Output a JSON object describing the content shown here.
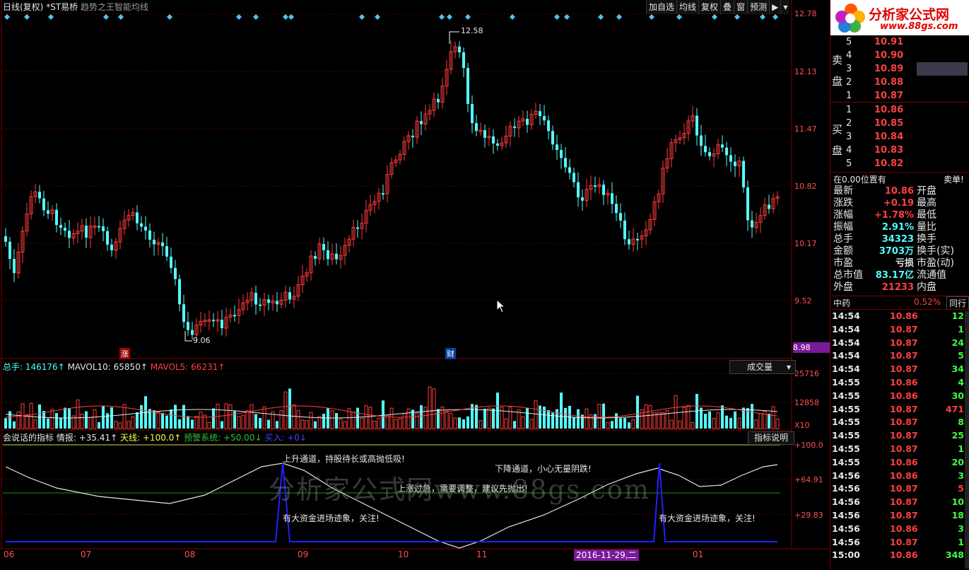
{
  "header": {
    "period": "日线(复权)",
    "stock": "*ST易桥",
    "indicator": "趋势之王智能均线",
    "buttons": [
      "加自选",
      "均线",
      "复权",
      "叠",
      "窗",
      "预测"
    ],
    "arrow": "▶"
  },
  "logo": {
    "title": "分析家公式网",
    "url": "www.88gs.com"
  },
  "price_axis": [
    "12.78",
    "12.13",
    "11.47",
    "10.82",
    "10.17",
    "9.52",
    "8.98"
  ],
  "markers": {
    "high": "12.58",
    "low": "9.06",
    "zhang": "涨",
    "cai": "财"
  },
  "volume": {
    "total_label": "总手:",
    "total": "146176",
    "mavol10_label": "MAVOL10:",
    "mavol10": "65850",
    "mavol5_label": "MAVOL5:",
    "mavol5": "66231",
    "selector": "成交量",
    "axis": [
      "25716",
      "12858"
    ],
    "unit": "X10"
  },
  "indicator_panel": {
    "name": "会说话的指标",
    "qingbao": "情报: +35.41",
    "tianxian": "天线: +100.0",
    "yujing": "预警系统: +50.00",
    "mairu": "买入: +0",
    "help": "指标说明",
    "axis": [
      "+100.0",
      "+64.91",
      "+29.83"
    ],
    "texts": {
      "up": "上升通道，持股待长或高抛低吸!",
      "down": "下降通道，小心无量阴跌!",
      "overheat": "上涨过急，需要调整，建议先抛出!",
      "fund1": "有大资金进场迹象，关注!",
      "fund2": "有大资金进场迹象，关注!"
    }
  },
  "watermark": "分析家公式网www.88gs.com",
  "x_axis": {
    "labels": [
      "06",
      "07",
      "08",
      "09",
      "10",
      "11",
      "12",
      "01"
    ],
    "cursor_date": "2016-11-29,二"
  },
  "orderbook": {
    "sell_label": [
      "卖",
      "盘"
    ],
    "buy_label": [
      "买",
      "盘"
    ],
    "sell": [
      {
        "lv": "5",
        "price": "10.91"
      },
      {
        "lv": "4",
        "price": "10.90"
      },
      {
        "lv": "3",
        "price": "10.89"
      },
      {
        "lv": "2",
        "price": "10.88"
      },
      {
        "lv": "1",
        "price": "10.87"
      }
    ],
    "buy": [
      {
        "lv": "1",
        "price": "10.86"
      },
      {
        "lv": "2",
        "price": "10.85"
      },
      {
        "lv": "3",
        "price": "10.84"
      },
      {
        "lv": "4",
        "price": "10.83"
      },
      {
        "lv": "5",
        "price": "10.82"
      }
    ]
  },
  "status": {
    "position": "在0.00位置有",
    "sell_order": "卖单!",
    "rows": [
      {
        "k": "最新",
        "v": "10.86",
        "k2": "开盘"
      },
      {
        "k": "涨跌",
        "v": "+0.19",
        "k2": "最高"
      },
      {
        "k": "涨幅",
        "v": "+1.78%",
        "k2": "最低"
      },
      {
        "k": "振幅",
        "v": "2.91%",
        "k2": "量比"
      },
      {
        "k": "总手",
        "v": "34323",
        "k2": "换手"
      },
      {
        "k": "金额",
        "v": "3703万",
        "k2": "换手(实)"
      },
      {
        "k": "市盈",
        "v": "亏损",
        "k2": "市盈(动)"
      },
      {
        "k": "总市值",
        "v": "83.17亿",
        "k2": "流通值"
      },
      {
        "k": "外盘",
        "v": "21233",
        "k2": "内盘"
      }
    ],
    "sector": "中药",
    "sector_pct": "0.52%",
    "sector_btn": "同行"
  },
  "ticks": [
    {
      "t": "14:54",
      "p": "10.86",
      "v": "12",
      "c": "#40ff40"
    },
    {
      "t": "14:54",
      "p": "10.87",
      "v": "1",
      "c": "#40ff40"
    },
    {
      "t": "14:54",
      "p": "10.87",
      "v": "24",
      "c": "#40ff40"
    },
    {
      "t": "14:54",
      "p": "10.87",
      "v": "5",
      "c": "#40ff40"
    },
    {
      "t": "14:54",
      "p": "10.87",
      "v": "34",
      "c": "#40ff40"
    },
    {
      "t": "14:55",
      "p": "10.86",
      "v": "4",
      "c": "#40ff40"
    },
    {
      "t": "14:55",
      "p": "10.86",
      "v": "30",
      "c": "#40ff40"
    },
    {
      "t": "14:55",
      "p": "10.87",
      "v": "471",
      "c": "#ff4040"
    },
    {
      "t": "14:55",
      "p": "10.87",
      "v": "8",
      "c": "#40ff40"
    },
    {
      "t": "14:55",
      "p": "10.87",
      "v": "25",
      "c": "#40ff40"
    },
    {
      "t": "14:55",
      "p": "10.87",
      "v": "1",
      "c": "#40ff40"
    },
    {
      "t": "14:55",
      "p": "10.86",
      "v": "20",
      "c": "#40ff40"
    },
    {
      "t": "14:56",
      "p": "10.86",
      "v": "3",
      "c": "#40ff40"
    },
    {
      "t": "14:56",
      "p": "10.87",
      "v": "5",
      "c": "#ff4040"
    },
    {
      "t": "14:56",
      "p": "10.87",
      "v": "10",
      "c": "#40ff40"
    },
    {
      "t": "14:56",
      "p": "10.87",
      "v": "18",
      "c": "#40ff40"
    },
    {
      "t": "14:56",
      "p": "10.86",
      "v": "3",
      "c": "#40ff40"
    },
    {
      "t": "14:56",
      "p": "10.87",
      "v": "1",
      "c": "#40ff40"
    },
    {
      "t": "15:00",
      "p": "10.86",
      "v": "348",
      "c": "#40ff40"
    }
  ]
}
